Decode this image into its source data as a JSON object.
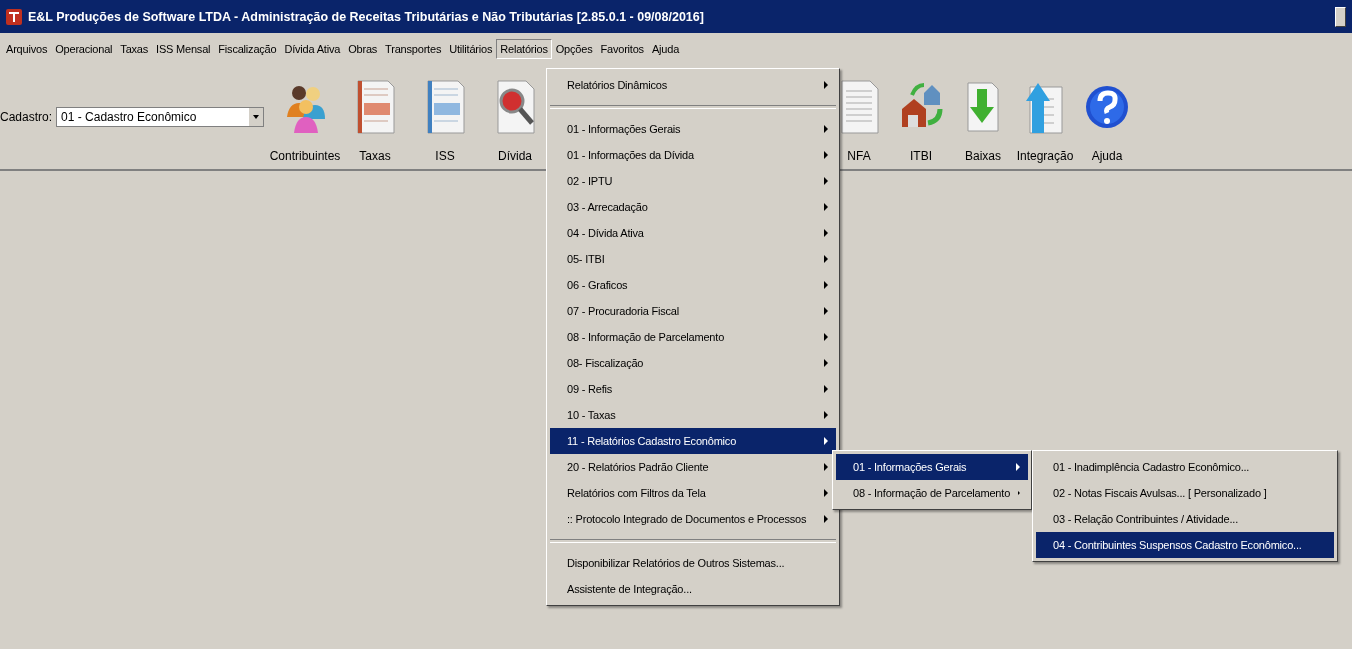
{
  "window": {
    "title": "E&L Produções de Software LTDA - Administração de Receitas Tributárias e Não Tributárias [2.85.0.1 - 09/08/2016]"
  },
  "menubar": [
    {
      "label": "Arquivos",
      "selected": false
    },
    {
      "label": "Operacional",
      "selected": false
    },
    {
      "label": "Taxas",
      "selected": false
    },
    {
      "label": "ISS Mensal",
      "selected": false
    },
    {
      "label": "Fiscalização",
      "selected": false
    },
    {
      "label": "Dívida Ativa",
      "selected": false
    },
    {
      "label": "Obras",
      "selected": false
    },
    {
      "label": "Transportes",
      "selected": false
    },
    {
      "label": "Utilitários",
      "selected": false
    },
    {
      "label": "Relatórios",
      "selected": true
    },
    {
      "label": "Opções",
      "selected": false
    },
    {
      "label": "Favoritos",
      "selected": false
    },
    {
      "label": "Ajuda",
      "selected": false
    }
  ],
  "cadastro": {
    "label": "Cadastro:",
    "value": "01 - Cadastro Econômico"
  },
  "toolbar_left": [
    {
      "label": "Contribuintes",
      "kind": "people"
    },
    {
      "label": "Taxas",
      "kind": "red-sheet"
    },
    {
      "label": "ISS",
      "kind": "blue-sheet"
    },
    {
      "label": "Dívida",
      "kind": "search-doc"
    }
  ],
  "toolbar_right": [
    {
      "label": "NFA",
      "kind": "plain-doc"
    },
    {
      "label": "ITBI",
      "kind": "house"
    },
    {
      "label": "Baixas",
      "kind": "down"
    },
    {
      "label": "Integração",
      "kind": "up"
    },
    {
      "label": "Ajuda",
      "kind": "help"
    }
  ],
  "menu": [
    {
      "kind": "item",
      "label": "Relatórios Dinâmicos",
      "submenu": true,
      "selected": false
    },
    {
      "kind": "separator"
    },
    {
      "kind": "item",
      "label": "01 - Informações Gerais",
      "submenu": true,
      "selected": false
    },
    {
      "kind": "item",
      "label": "01 - Informações da Dívida",
      "submenu": true,
      "selected": false
    },
    {
      "kind": "item",
      "label": "02 - IPTU",
      "submenu": true,
      "selected": false
    },
    {
      "kind": "item",
      "label": "03 - Arrecadação",
      "submenu": true,
      "selected": false
    },
    {
      "kind": "item",
      "label": "04 - Dívida Ativa",
      "submenu": true,
      "selected": false
    },
    {
      "kind": "item",
      "label": "05- ITBI",
      "submenu": true,
      "selected": false
    },
    {
      "kind": "item",
      "label": "06 - Graficos",
      "submenu": true,
      "selected": false
    },
    {
      "kind": "item",
      "label": "07 - Procuradoria Fiscal",
      "submenu": true,
      "selected": false
    },
    {
      "kind": "item",
      "label": "08 - Informação de Parcelamento",
      "submenu": true,
      "selected": false
    },
    {
      "kind": "item",
      "label": "08- Fiscalização",
      "submenu": true,
      "selected": false
    },
    {
      "kind": "item",
      "label": "09 - Refis",
      "submenu": true,
      "selected": false
    },
    {
      "kind": "item",
      "label": "10 - Taxas",
      "submenu": true,
      "selected": false
    },
    {
      "kind": "item",
      "label": "11 - Relatórios Cadastro Econômico",
      "submenu": true,
      "selected": true
    },
    {
      "kind": "item",
      "label": "20 - Relatórios Padrão Cliente",
      "submenu": true,
      "selected": false
    },
    {
      "kind": "item",
      "label": "Relatórios com Filtros da Tela",
      "submenu": true,
      "selected": false
    },
    {
      "kind": "item",
      "label": ":: Protocolo Integrado de Documentos e Processos",
      "submenu": true,
      "selected": false
    },
    {
      "kind": "separator"
    },
    {
      "kind": "item",
      "label": "Disponibilizar Relatórios de Outros Sistemas...",
      "submenu": false,
      "selected": false
    },
    {
      "kind": "item",
      "label": "Assistente de Integração...",
      "submenu": false,
      "selected": false
    }
  ],
  "submenu": [
    {
      "kind": "item",
      "label": "01 - Informações Gerais",
      "submenu": true,
      "selected": true
    },
    {
      "kind": "item",
      "label": "08 - Informação de Parcelamento",
      "submenu": true,
      "selected": false
    }
  ],
  "submenu_2": [
    {
      "kind": "item",
      "label": "01 - Inadimplência Cadastro Econômico...",
      "submenu": false,
      "selected": false
    },
    {
      "kind": "item",
      "label": "02 - Notas Fiscais Avulsas... [ Personalizado ]",
      "submenu": false,
      "selected": false
    },
    {
      "kind": "item",
      "label": "03 - Relação Contribuintes / Atividade...",
      "submenu": false,
      "selected": false
    },
    {
      "kind": "item",
      "label": "04 - Contribuintes Suspensos Cadastro Econômico...",
      "submenu": false,
      "selected": true
    }
  ]
}
